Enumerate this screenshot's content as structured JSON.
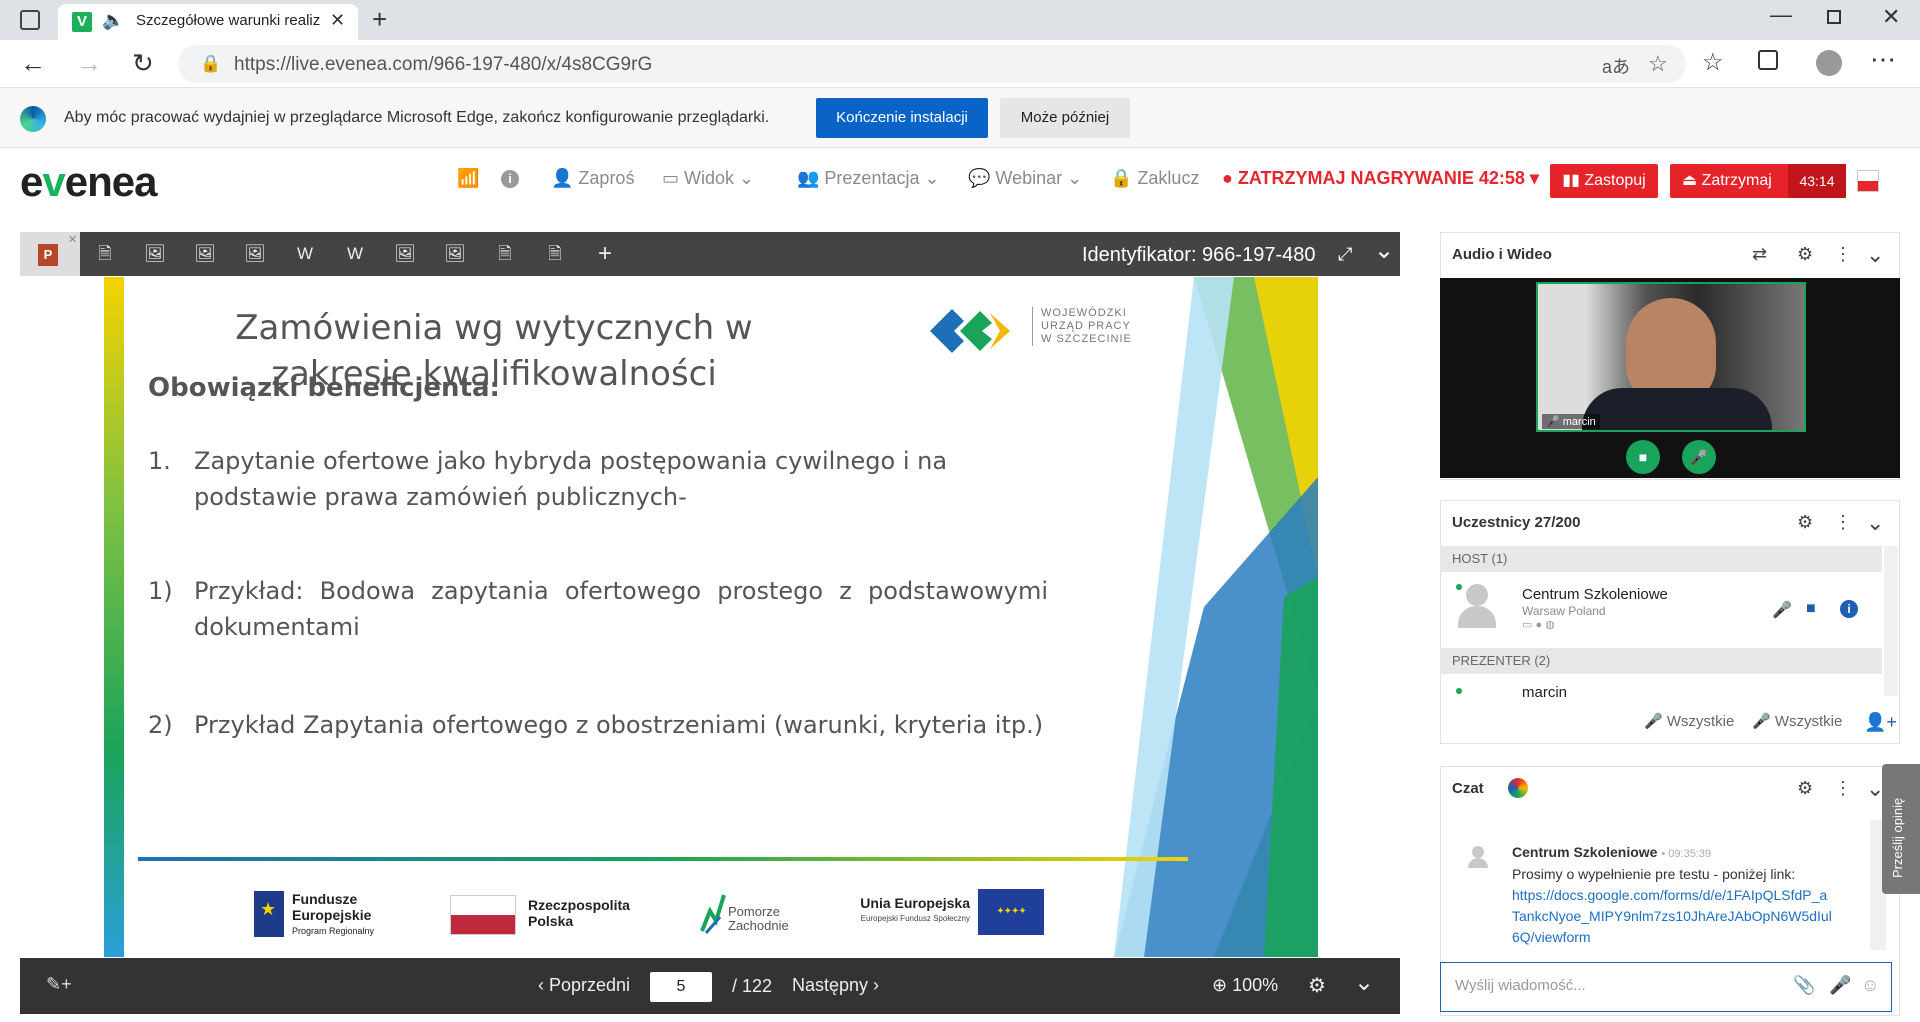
{
  "browser": {
    "favicon_letter": "V",
    "tab_title": "Szczegółowe warunki realiz",
    "url": "https://live.evenea.com/966-197-480/x/4s8CG9rG"
  },
  "infobar": {
    "message": "Aby móc pracować wydajniej w przeglądarce Microsoft Edge, zakończ konfigurowanie przeglądarki.",
    "primary_button": "Kończenie instalacji",
    "secondary_button": "Może później"
  },
  "app": {
    "logo_part1": "e",
    "logo_accent": "v",
    "logo_part2": "enea",
    "menu": {
      "invite": "Zaproś",
      "view": "Widok",
      "presentation": "Prezentacja",
      "webinar": "Webinar",
      "lock": "Zaklucz"
    },
    "recording": "ZATRZYMAJ NAGRYWANIE 42:58",
    "replace_button": "Zastopuj",
    "stop_button": "Zatrzymaj",
    "stop_timer": "43:14",
    "accent_color": "#e52329"
  },
  "viewer": {
    "ppt_letter": "P",
    "thumbnails": [
      "doc-icon",
      "image-icon",
      "image-icon",
      "image-icon",
      "word-icon",
      "word-icon",
      "image-icon",
      "image-icon",
      "doc-icon",
      "doc-icon",
      "add-icon"
    ],
    "meeting_id": "Identyfikator: 966-197-480",
    "prev_label": "Poprzedni",
    "current_page": "5",
    "total_pages": "/ 122",
    "next_label": "Następny",
    "zoom": "100%"
  },
  "slide": {
    "title": "Zamówienia wg wytycznych w zakresie kwalifikowalności",
    "logo_lines": [
      "WOJEWÓDZKI",
      "URZĄD PRACY",
      "W SZCZECINIE"
    ],
    "subtitle": "Obowiązki beneficjenta:",
    "items": [
      {
        "marker": "1.",
        "text": "Zapytanie ofertowe jako hybryda postępowania cywilnego i na podstawie prawa zamówień publicznych-"
      },
      {
        "marker": "1)",
        "text": "Przykład: Bodowa zapytania ofertowego prostego z podstawowymi dokumentami"
      },
      {
        "marker": "2)",
        "text": "Przykład Zapytania ofertowego z obostrzeniami (warunki, kryteria itp.)"
      }
    ],
    "footer": {
      "fundusze": [
        "Fundusze",
        "Europejskie",
        "Program Regionalny"
      ],
      "rp": [
        "Rzeczpospolita",
        "Polska"
      ],
      "pomorze": [
        "Pomorze",
        "Zachodnie"
      ],
      "ue": [
        "Unia Europejska",
        "Europejski Fundusz Społeczny"
      ]
    }
  },
  "side": {
    "av_title": "Audio i Wideo",
    "video_name": "marcin",
    "participants_title": "Uczestnicy 27/200",
    "host_header": "HOST (1)",
    "host_name": "Centrum Szkoleniowe",
    "host_location": "Warsaw Poland",
    "presenter_header": "PREZENTER (2)",
    "presenter_name": "marcin",
    "all_label_1": "Wszystkie",
    "all_label_2": "Wszystkie",
    "chat_title": "Czat",
    "feedback": "Prześlij opinię"
  },
  "chat": {
    "messages": [
      {
        "sender": "Centrum Szkoleniowe",
        "time": "09:35:39",
        "text": "Prosimy o wypełnienie pre testu - poniżej link:",
        "link": "https://docs.google.com/forms/d/e/1FAIpQLSfdP_aTankcNyoe_MIPY9nlm7zs10JhAreJAbOpN6W5dIul6Q/viewform"
      }
    ],
    "placeholder": "Wyślij wiadomość..."
  }
}
